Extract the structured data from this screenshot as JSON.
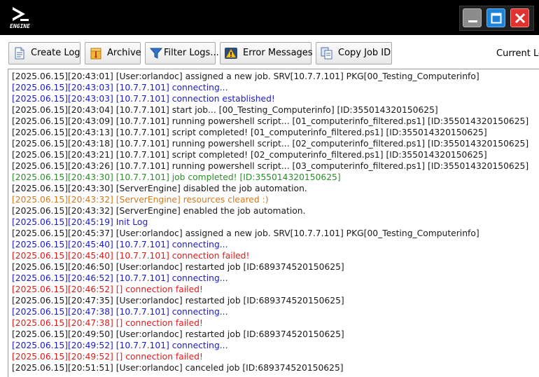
{
  "app": {
    "logo_text": "ENGINE"
  },
  "window_controls": {
    "minimize_icon": "minimize-icon",
    "maximize_icon": "maximize-icon",
    "close_icon": "close-icon"
  },
  "toolbar": {
    "buttons": [
      {
        "label": "Create Log",
        "icon": "document-icon"
      },
      {
        "label": "Archive",
        "icon": "archive-icon"
      },
      {
        "label": "Filter Logs...",
        "icon": "filter-icon"
      },
      {
        "label": "Error Messages",
        "icon": "warning-icon"
      },
      {
        "label": "Copy Job ID",
        "icon": "copy-icon"
      }
    ],
    "current_label": "Current Lo"
  },
  "colors": {
    "black": "#1a1a1a",
    "blue": "#1b1bcc",
    "red": "#e11a1a",
    "green": "#2e8b2e",
    "orange": "#d2781e"
  },
  "log": [
    {
      "text": "[2025.06.15][20:43:01] [User:orlandoc] assigned a new job. SRV[10.7.7.101] PKG[00_Testing_Computerinfo]",
      "color": "black"
    },
    {
      "text": "[2025.06.15][20:43:03] [10.7.7.101] connecting...",
      "color": "blue"
    },
    {
      "text": "[2025.06.15][20:43:03] [10.7.7.101] connection established!",
      "color": "blue"
    },
    {
      "text": "[2025.06.15][20:43:04] [10.7.7.101] start job... [00_Testing_Computerinfo] [ID:355014320150625]",
      "color": "black"
    },
    {
      "text": "[2025.06.15][20:43:09] [10.7.7.101] running powershell script... [01_computerinfo_filtered.ps1] [ID:355014320150625]",
      "color": "black"
    },
    {
      "text": "[2025.06.15][20:43:13] [10.7.7.101] script completed! [01_computerinfo_filtered.ps1] [ID:355014320150625]",
      "color": "black"
    },
    {
      "text": "[2025.06.15][20:43:18] [10.7.7.101] running powershell script... [02_computerinfo_filtered.ps1] [ID:355014320150625]",
      "color": "black"
    },
    {
      "text": "[2025.06.15][20:43:21] [10.7.7.101] script completed! [02_computerinfo_filtered.ps1] [ID:355014320150625]",
      "color": "black"
    },
    {
      "text": "[2025.06.15][20:43:26] [10.7.7.101] running powershell script... [03_computerinfo_filtered.ps1] [ID:355014320150625]",
      "color": "black"
    },
    {
      "text": "[2025.06.15][20:43:30] [10.7.7.101] job completed! [ID:355014320150625]",
      "color": "green"
    },
    {
      "text": "[2025.06.15][20:43:30] [ServerEngine] disabled the job automation.",
      "color": "black"
    },
    {
      "text": "[2025.06.15][20:43:32] [ServerEngine] resources cleared :)",
      "color": "orange"
    },
    {
      "text": "[2025.06.15][20:43:32] [ServerEngine] enabled the job automation.",
      "color": "black"
    },
    {
      "text": "[2025.06.15][20:45:19] Init Log",
      "color": "blue"
    },
    {
      "text": "[2025.06.15][20:45:37] [User:orlandoc] assigned a new job. SRV[10.7.7.101] PKG[00_Testing_Computerinfo]",
      "color": "black"
    },
    {
      "text": "[2025.06.15][20:45:40] [10.7.7.101] connecting...",
      "color": "blue"
    },
    {
      "text": "[2025.06.15][20:45:40] [10.7.7.101] connection failed!",
      "color": "red"
    },
    {
      "text": "[2025.06.15][20:46:50] [User:orlandoc] restarted job [ID:689374520150625]",
      "color": "black"
    },
    {
      "text": "[2025.06.15][20:46:52] [10.7.7.101] connecting...",
      "color": "blue"
    },
    {
      "text": "[2025.06.15][20:46:52] [] connection failed!",
      "color": "red"
    },
    {
      "text": "[2025.06.15][20:47:35] [User:orlandoc] restarted job [ID:689374520150625]",
      "color": "black"
    },
    {
      "text": "[2025.06.15][20:47:38] [10.7.7.101] connecting...",
      "color": "blue"
    },
    {
      "text": "[2025.06.15][20:47:38] [] connection failed!",
      "color": "red"
    },
    {
      "text": "[2025.06.15][20:49:50] [User:orlandoc] restarted job [ID:689374520150625]",
      "color": "black"
    },
    {
      "text": "[2025.06.15][20:49:52] [10.7.7.101] connecting...",
      "color": "blue"
    },
    {
      "text": "[2025.06.15][20:49:52] [] connection failed!",
      "color": "red"
    },
    {
      "text": "[2025.06.15][20:51:51] [User:orlandoc] canceled job [ID:689374520150625]",
      "color": "black"
    }
  ]
}
